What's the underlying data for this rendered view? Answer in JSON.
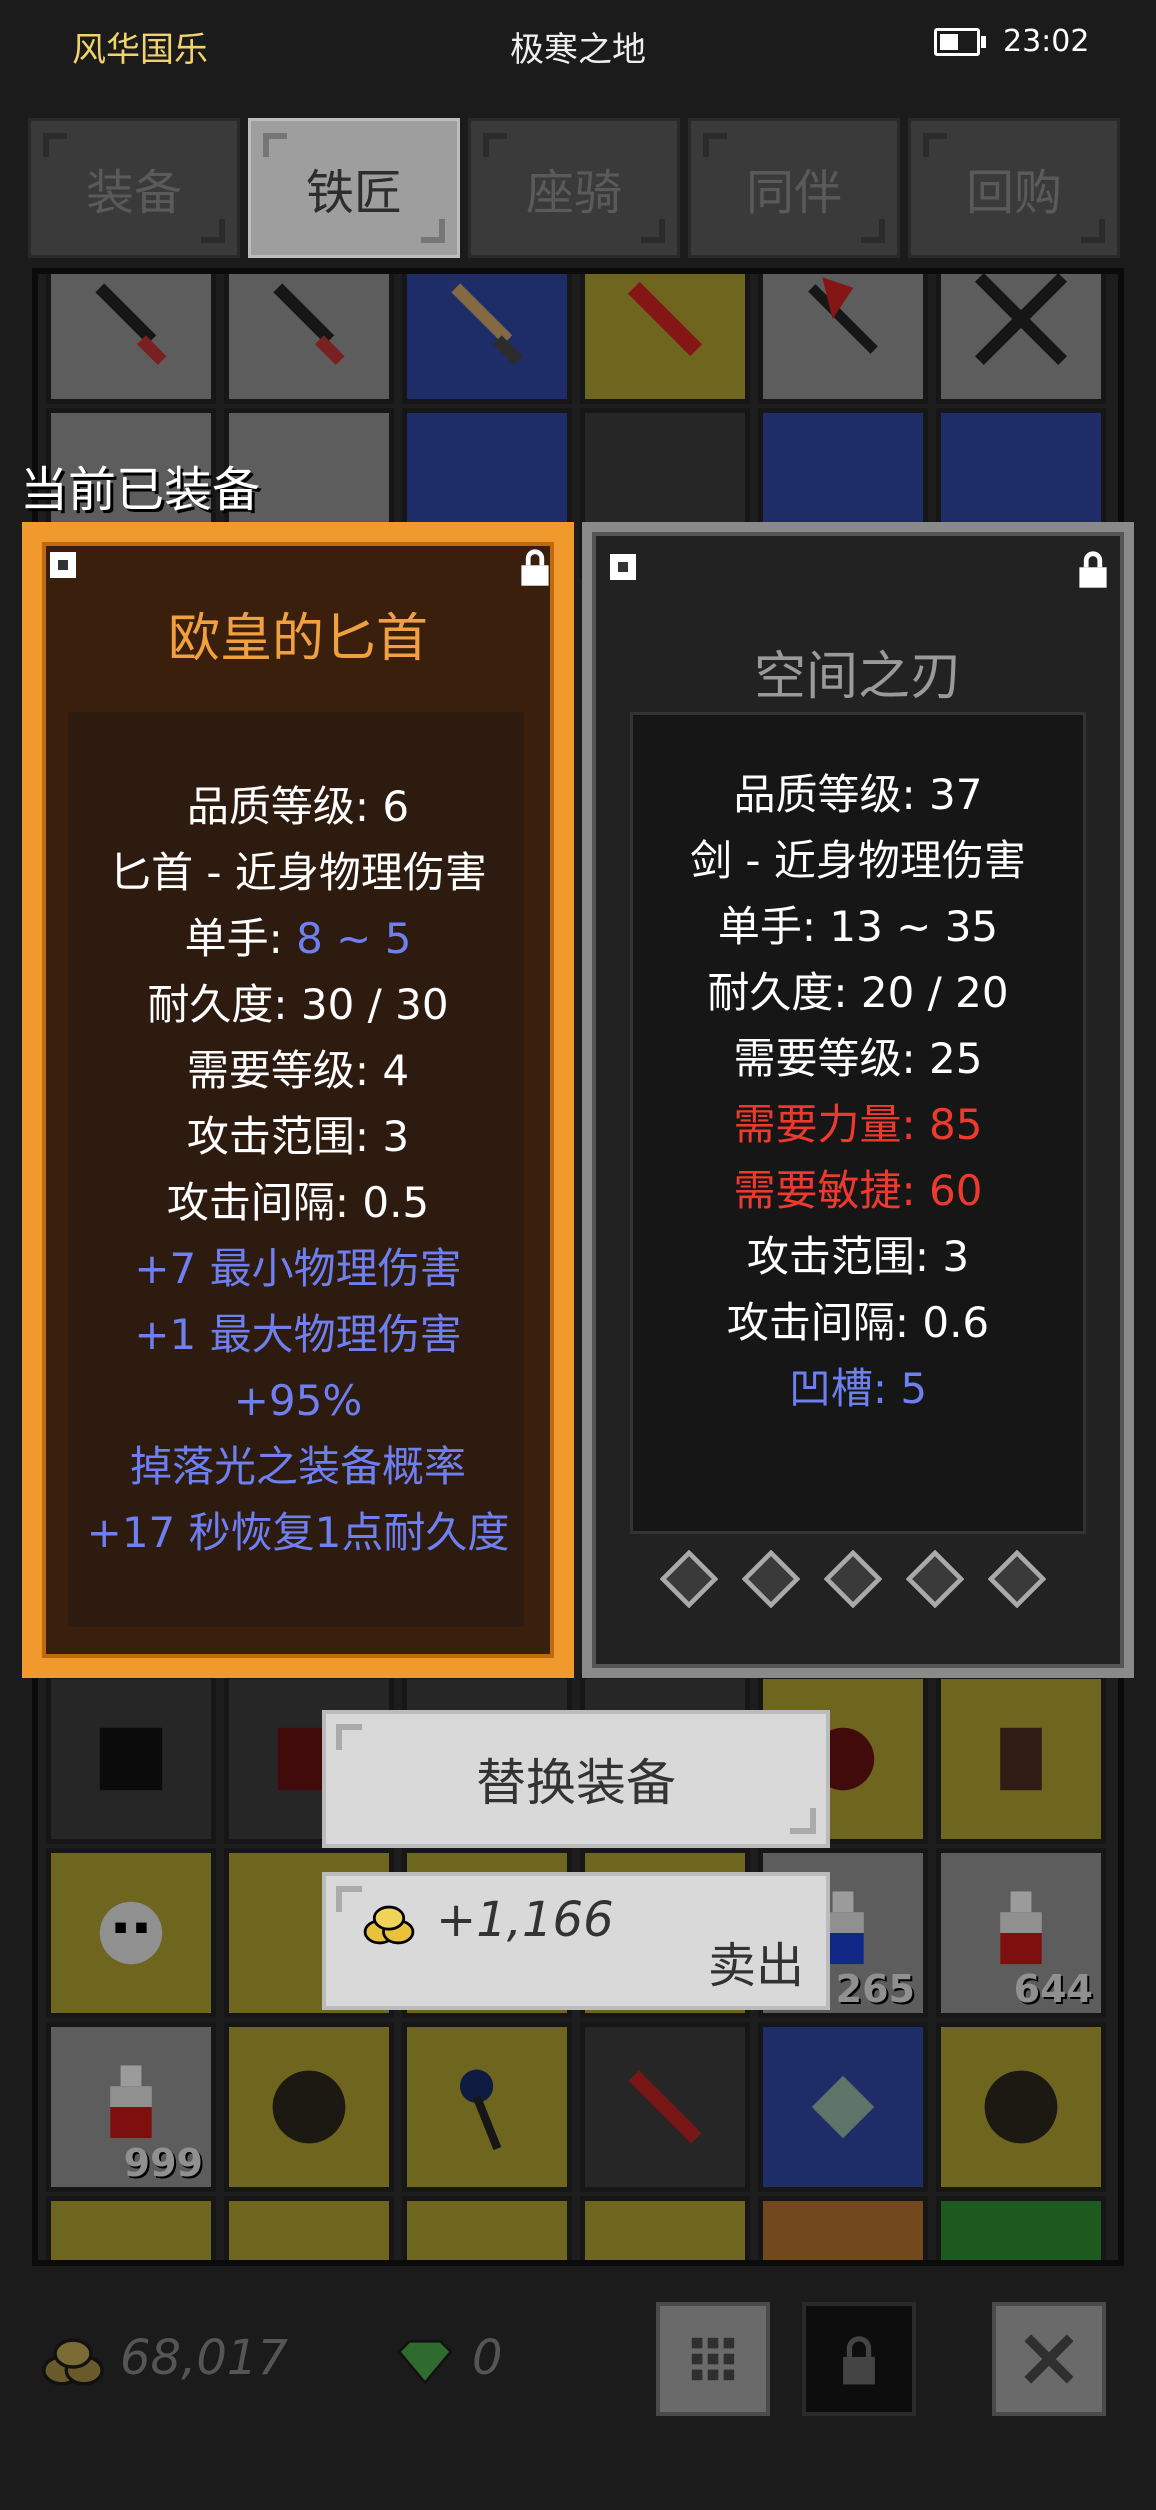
{
  "status_bar": {
    "left": "风华国乐",
    "center": "极寒之地",
    "time": "23:02"
  },
  "tabs": [
    {
      "label": "装备",
      "active": false
    },
    {
      "label": "铁匠",
      "active": true
    },
    {
      "label": "座骑",
      "active": false
    },
    {
      "label": "同伴",
      "active": false
    },
    {
      "label": "回购",
      "active": false
    }
  ],
  "equipped_label": "当前已装备",
  "equipped_item": {
    "name": "欧皇的匕首",
    "name_color": "#f0a040",
    "stats": [
      {
        "text": "品质等级: 6",
        "color": "white"
      },
      {
        "text": "匕首 - 近身物理伤害",
        "color": "white"
      },
      {
        "label": "单手: ",
        "value": "8 ~ 5",
        "color": "white"
      },
      {
        "text": "耐久度: 30 / 30",
        "color": "white"
      },
      {
        "text": "需要等级: 4",
        "color": "white"
      },
      {
        "text": "攻击范围: 3",
        "color": "white"
      },
      {
        "text": "攻击间隔: 0.5",
        "color": "white"
      },
      {
        "text": "+7 最小物理伤害",
        "color": "blue"
      },
      {
        "text": "+1 最大物理伤害",
        "color": "blue"
      },
      {
        "text": "+95%",
        "color": "blue"
      },
      {
        "text": "掉落光之装备概率",
        "color": "blue"
      },
      {
        "text": "+17 秒恢复1点耐久度",
        "color": "blue"
      }
    ]
  },
  "compare_item": {
    "name": "空间之刃",
    "name_color": "#9a9a9a",
    "stats": [
      {
        "text": "品质等级: 37",
        "color": "white"
      },
      {
        "text": "剑 - 近身物理伤害",
        "color": "white"
      },
      {
        "text": "单手: 13 ~ 35",
        "color": "white"
      },
      {
        "text": "耐久度: 20 / 20",
        "color": "white"
      },
      {
        "text": "需要等级: 25",
        "color": "white"
      },
      {
        "text": "需要力量: 85",
        "color": "red"
      },
      {
        "text": "需要敏捷: 60",
        "color": "red"
      },
      {
        "text": "攻击范围: 3",
        "color": "white"
      },
      {
        "text": "攻击间隔: 0.6",
        "color": "white"
      },
      {
        "text": "凹槽: 5",
        "color": "blue"
      }
    ],
    "socket_count": 5
  },
  "actions": {
    "replace_label": "替换装备",
    "sell_amount": "+1,166",
    "sell_label": "卖出"
  },
  "inventory_counts": [
    "265",
    "644",
    "999"
  ],
  "currency": {
    "gold": "68,017",
    "gems": "0"
  },
  "colors": {
    "accent_orange": "#f09a2e",
    "stat_blue": "#6e7ff0",
    "stat_red": "#ee3a2e",
    "title_yellow": "#f2d36b"
  },
  "icons": [
    "battery-icon",
    "lock-icon",
    "gold-coins-icon",
    "emerald-gem-icon",
    "grid-icon",
    "close-icon"
  ]
}
